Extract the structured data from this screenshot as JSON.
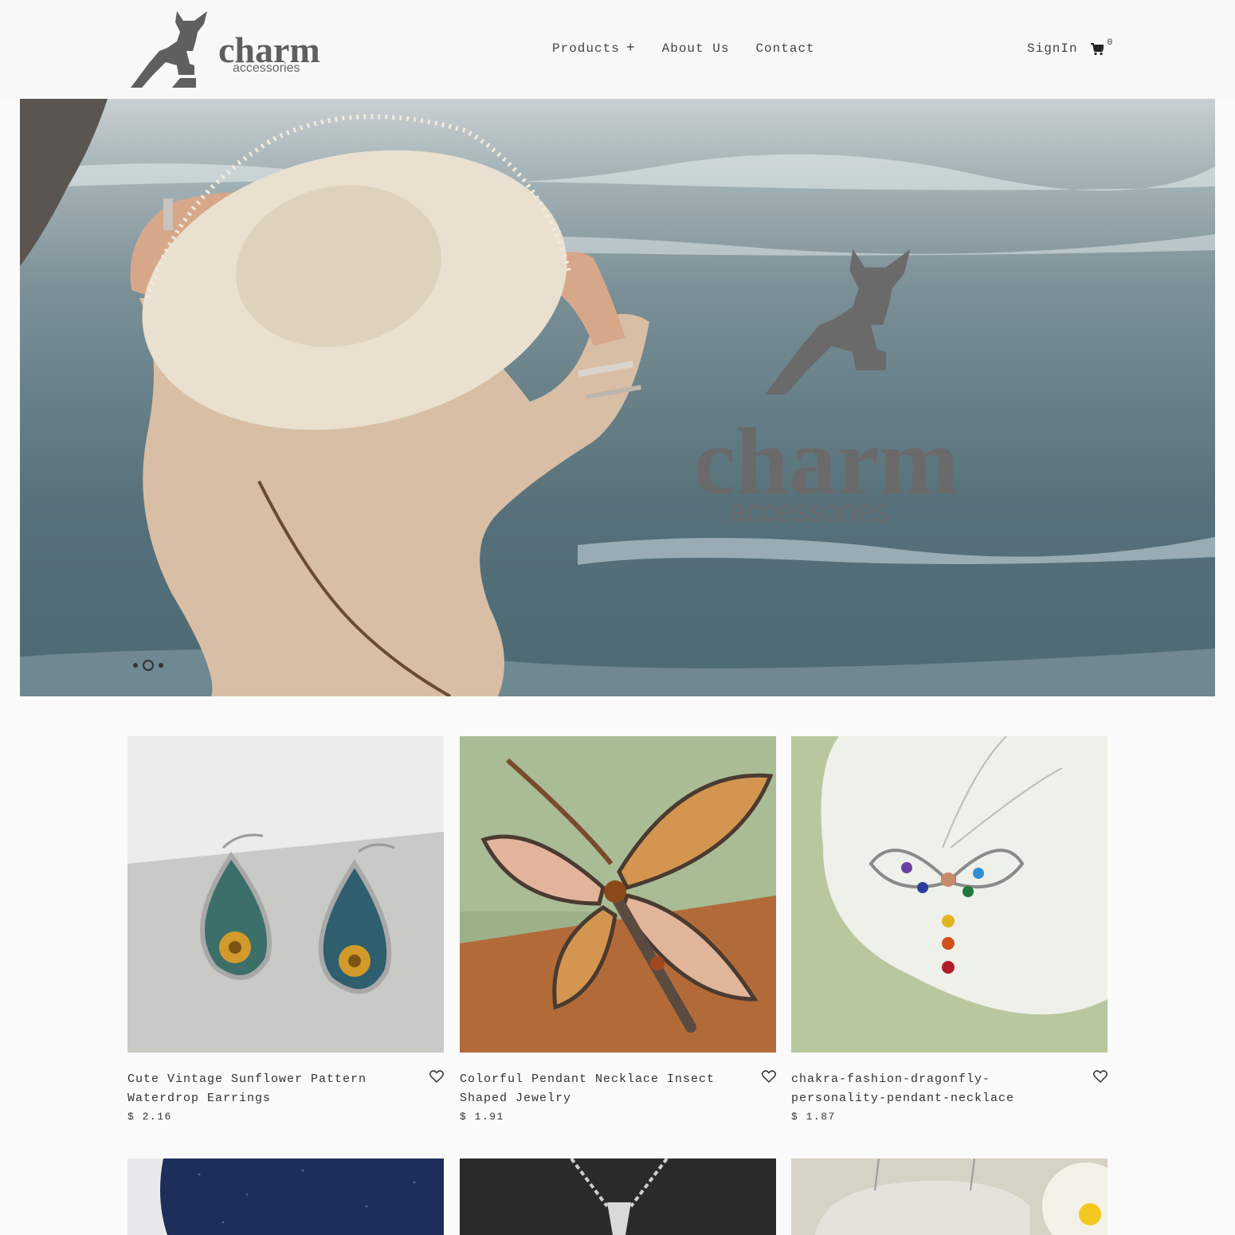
{
  "header": {
    "brand_name": "charm",
    "brand_sub": "accessories",
    "nav": [
      {
        "label": "Products",
        "has_submenu": true
      },
      {
        "label": "About Us",
        "has_submenu": false
      },
      {
        "label": "Contact",
        "has_submenu": false
      }
    ],
    "signin_label": "SignIn",
    "cart_count": "0"
  },
  "hero": {
    "brand_name": "charm",
    "brand_sub": "accessories",
    "slides": 3,
    "active_slide": 2
  },
  "products": [
    {
      "name": "Cute Vintage Sunflower Pattern Waterdrop Earrings",
      "price": "$ 2.16"
    },
    {
      "name": "Colorful Pendant Necklace Insect Shaped Jewelry",
      "price": "$ 1.91"
    },
    {
      "name": "chakra-fashion-dragonfly-personality-pendant-necklace",
      "price": "$ 1.87"
    }
  ],
  "colors": {
    "brand_gray": "#666666",
    "background": "#fafafa",
    "text": "#333333"
  },
  "icons": [
    "kangaroo-logo-icon",
    "plus-icon",
    "cart-icon",
    "heart-icon"
  ]
}
